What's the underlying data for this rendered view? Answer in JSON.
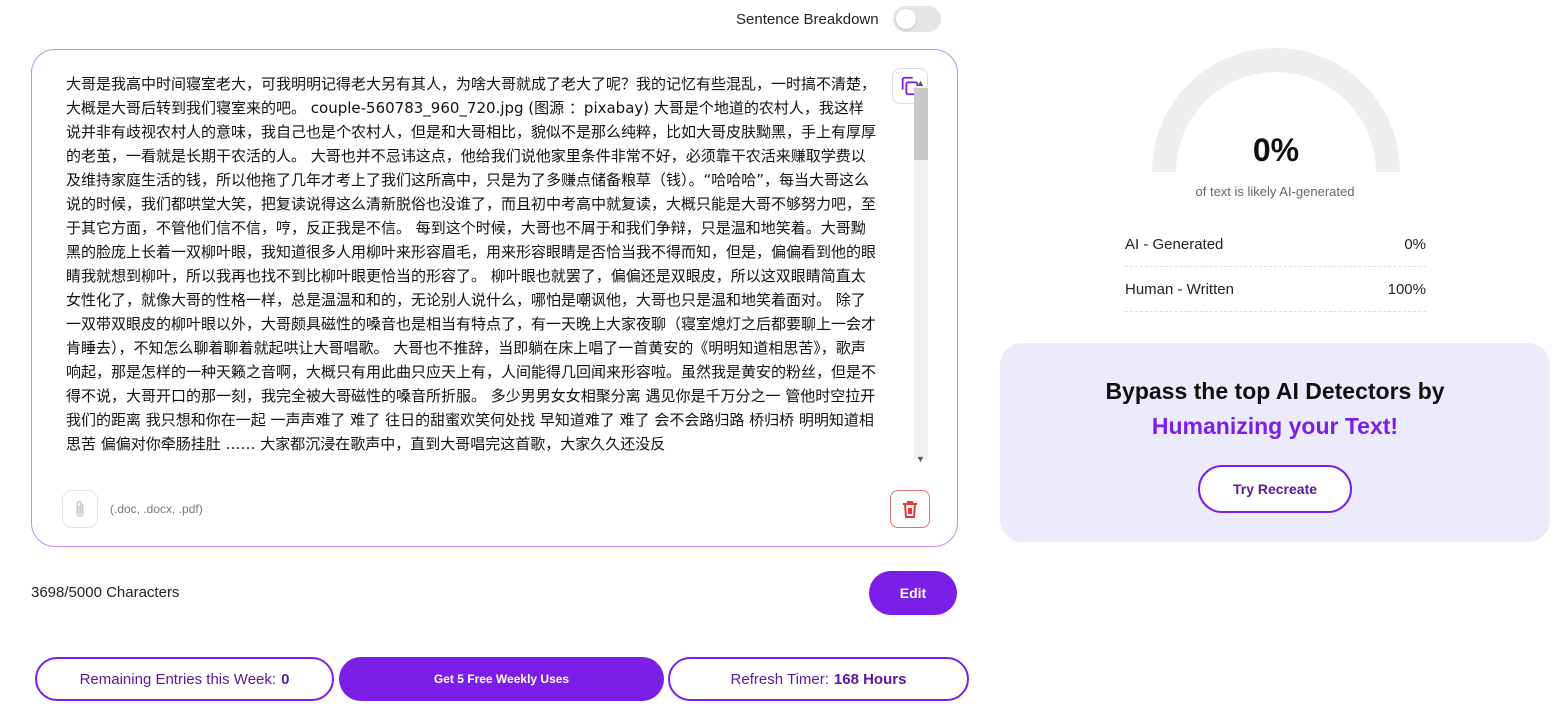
{
  "toggle": {
    "label": "Sentence Breakdown",
    "on": false
  },
  "editor": {
    "text": "大哥是我高中时间寝室老大，可我明明记得老大另有其人，为啥大哥就成了老大了呢？我的记忆有些混乱，一时搞不清楚，大概是大哥后转到我们寝室来的吧。 couple-560783_960_720.jpg (图源 ：pixabay) 大哥是个地道的农村人，我这样说并非有歧视农村人的意味，我自己也是个农村人，但是和大哥相比，貌似不是那么纯粹，比如大哥皮肤黝黑，手上有厚厚的老茧，一看就是长期干农活的人。 大哥也并不忌讳这点，他给我们说他家里条件非常不好，必须靠干农活来赚取学费以及维持家庭生活的钱，所以他拖了几年才考上了我们这所高中，只是为了多赚点储备粮草（钱）。“哈哈哈”，每当大哥这么说的时候，我们都哄堂大笑，把复读说得这么清新脱俗也没谁了，而且初中考高中就复读，大概只能是大哥不够努力吧，至于其它方面，不管他们信不信，哼，反正我是不信。 每到这个时候，大哥也不屑于和我们争辩，只是温和地笑着。大哥黝黑的脸庞上长着一双柳叶眼，我知道很多人用柳叶来形容眉毛，用来形容眼睛是否恰当我不得而知，但是，偏偏看到他的眼睛我就想到柳叶，所以我再也找不到比柳叶眼更恰当的形容了。 柳叶眼也就罢了，偏偏还是双眼皮，所以这双眼睛简直太女性化了，就像大哥的性格一样，总是温温和和的，无论别人说什么，哪怕是嘲讽他，大哥也只是温和地笑着面对。 除了一双带双眼皮的柳叶眼以外，大哥颇具磁性的嗓音也是相当有特点了，有一天晚上大家夜聊（寝室熄灯之后都要聊上一会才肯睡去），不知怎么聊着聊着就起哄让大哥唱歌。 大哥也不推辞，当即躺在床上唱了一首黄安的《明明知道相思苦》，歌声响起，那是怎样的一种天籁之音啊，大概只有用此曲只应天上有，人间能得几回闻来形容啦。虽然我是黄安的粉丝，但是不得不说，大哥开口的那一刻，我完全被大哥磁性的嗓音所折服。 多少男男女女相聚分离 遇见你是千万分之一 管他时空拉开我们的距离 我只想和你在一起 一声声难了 难了 往日的甜蜜欢笑何处找 早知道难了 难了 会不会路归路 桥归桥 明明知道相思苦 偏偏对你牵肠挂肚 …… 大家都沉浸在歌声中，直到大哥唱完这首歌，大家久久还没反",
    "attach_hint": "(.doc, .docx, .pdf)"
  },
  "char_count": "3698/5000 Characters",
  "edit_label": "Edit",
  "bottom": {
    "remaining_label": "Remaining Entries this Week:",
    "remaining_value": "0",
    "free_label": "Get 5 Free Weekly Uses",
    "refresh_label": "Refresh Timer:",
    "refresh_value": "168 Hours"
  },
  "result": {
    "percent": "0%",
    "percent_value": 0,
    "subtitle": "of text is likely AI-generated",
    "rows": [
      {
        "label": "AI - Generated",
        "value": "0%"
      },
      {
        "label": "Human - Written",
        "value": "100%"
      }
    ]
  },
  "promo": {
    "title": "Bypass the top AI Detectors by",
    "accent": "Humanizing your Text!",
    "button": "Try Recreate"
  },
  "colors": {
    "accent": "#7b1fe8",
    "delete": "#e53935",
    "gauge_track": "#eeeeee"
  }
}
